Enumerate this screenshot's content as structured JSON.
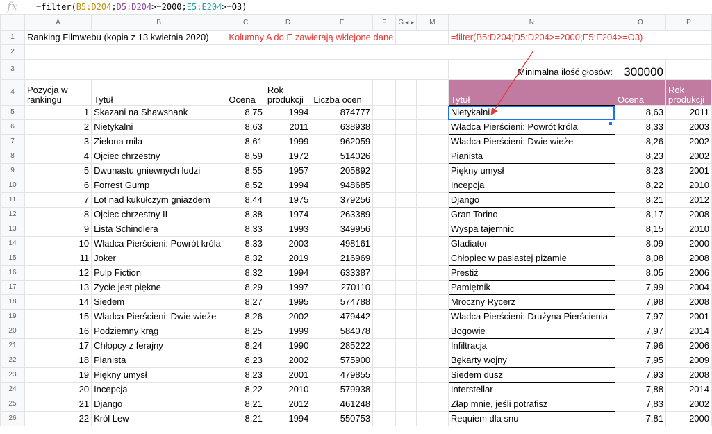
{
  "formula_bar": {
    "icon": "fx",
    "p0": "=filter(",
    "r1": "B5:D204",
    "p1": ";",
    "r2": "D5:D204",
    "p2": ">=2000;",
    "r3": "E5:E204",
    "p3": ">=O3)"
  },
  "columns": [
    "A",
    "B",
    "C",
    "D",
    "E",
    "F",
    "G",
    "M",
    "N",
    "O",
    "P"
  ],
  "hidden_marker": "◂ ▸",
  "row_numbers": [
    "1",
    "2",
    "3",
    "4",
    "5",
    "6",
    "7",
    "8",
    "9",
    "10",
    "11",
    "12",
    "13",
    "14",
    "15",
    "16",
    "17",
    "18",
    "19",
    "20",
    "21",
    "22",
    "23",
    "24",
    "25",
    "26"
  ],
  "row1": {
    "title": "Ranking Filmwebu (kopia z 13 kwietnia 2020)",
    "note": "Kolumny A do E zawierają wklejone dane",
    "formula_note": "=filter(B5:D204;D5:D204>=2000;E5:E204>=O3)"
  },
  "row3": {
    "min_label": "Minimalna ilość głosów:",
    "min_value": "300000"
  },
  "left_headers": {
    "rank": "Pozycja w rankingu",
    "title": "Tytuł",
    "rating": "Ocena",
    "year": "Rok produkcji",
    "votes": "Liczba ocen"
  },
  "right_headers": {
    "title": "Tytuł",
    "rating": "Ocena",
    "year": "Rok produkcji"
  },
  "left_rows": [
    [
      "1",
      "Skazani na Shawshank",
      "8,75",
      "1994",
      "874777"
    ],
    [
      "2",
      "Nietykalni",
      "8,63",
      "2011",
      "638938"
    ],
    [
      "3",
      "Zielona mila",
      "8,61",
      "1999",
      "962059"
    ],
    [
      "4",
      "Ojciec chrzestny",
      "8,59",
      "1972",
      "514026"
    ],
    [
      "5",
      "Dwunastu gniewnych ludzi",
      "8,55",
      "1957",
      "205892"
    ],
    [
      "6",
      "Forrest Gump",
      "8,52",
      "1994",
      "948685"
    ],
    [
      "7",
      "Lot nad kukułczym gniazdem",
      "8,44",
      "1975",
      "379256"
    ],
    [
      "8",
      "Ojciec chrzestny II",
      "8,38",
      "1974",
      "263389"
    ],
    [
      "9",
      "Lista Schindlera",
      "8,33",
      "1993",
      "349956"
    ],
    [
      "10",
      "Władca Pierścieni: Powrót króla",
      "8,33",
      "2003",
      "498161"
    ],
    [
      "11",
      "Joker",
      "8,32",
      "2019",
      "216969"
    ],
    [
      "12",
      "Pulp Fiction",
      "8,32",
      "1994",
      "633387"
    ],
    [
      "13",
      "Życie jest piękne",
      "8,29",
      "1997",
      "270110"
    ],
    [
      "14",
      "Siedem",
      "8,27",
      "1995",
      "574788"
    ],
    [
      "15",
      "Władca Pierścieni: Dwie wieże",
      "8,26",
      "2002",
      "479442"
    ],
    [
      "16",
      "Podziemny krąg",
      "8,25",
      "1999",
      "584078"
    ],
    [
      "17",
      "Chłopcy z ferajny",
      "8,24",
      "1990",
      "285222"
    ],
    [
      "18",
      "Pianista",
      "8,23",
      "2002",
      "575900"
    ],
    [
      "19",
      "Piękny umysł",
      "8,23",
      "2001",
      "479855"
    ],
    [
      "20",
      "Incepcja",
      "8,22",
      "2010",
      "579938"
    ],
    [
      "21",
      "Django",
      "8,21",
      "2012",
      "461248"
    ],
    [
      "22",
      "Król Lew",
      "8,21",
      "1994",
      "550753"
    ]
  ],
  "right_rows": [
    [
      "Nietykalni",
      "8,63",
      "2011"
    ],
    [
      "Władca Pierścieni: Powrót króla",
      "8,33",
      "2003"
    ],
    [
      "Władca Pierścieni: Dwie wieże",
      "8,26",
      "2002"
    ],
    [
      "Pianista",
      "8,23",
      "2002"
    ],
    [
      "Piękny umysł",
      "8,23",
      "2001"
    ],
    [
      "Incepcja",
      "8,22",
      "2010"
    ],
    [
      "Django",
      "8,21",
      "2012"
    ],
    [
      "Gran Torino",
      "8,17",
      "2008"
    ],
    [
      "Wyspa tajemnic",
      "8,15",
      "2010"
    ],
    [
      "Gladiator",
      "8,09",
      "2000"
    ],
    [
      "Chłopiec w pasiastej piżamie",
      "8,08",
      "2008"
    ],
    [
      "Prestiż",
      "8,05",
      "2006"
    ],
    [
      "Pamiętnik",
      "7,99",
      "2004"
    ],
    [
      "Mroczny Rycerz",
      "7,98",
      "2008"
    ],
    [
      "Władca Pierścieni: Drużyna Pierścienia",
      "7,97",
      "2001"
    ],
    [
      "Bogowie",
      "7,97",
      "2014"
    ],
    [
      "Infiltracja",
      "7,96",
      "2006"
    ],
    [
      "Bękarty wojny",
      "7,95",
      "2009"
    ],
    [
      "Siedem dusz",
      "7,93",
      "2008"
    ],
    [
      "Interstellar",
      "7,88",
      "2014"
    ],
    [
      "Złap mnie, jeśli potrafisz",
      "7,83",
      "2002"
    ],
    [
      "Requiem dla snu",
      "7,81",
      "2000"
    ]
  ],
  "colors": {
    "header_pink": "#c27ba0",
    "note_red": "#e53935",
    "selection_blue": "#1a73e8"
  }
}
